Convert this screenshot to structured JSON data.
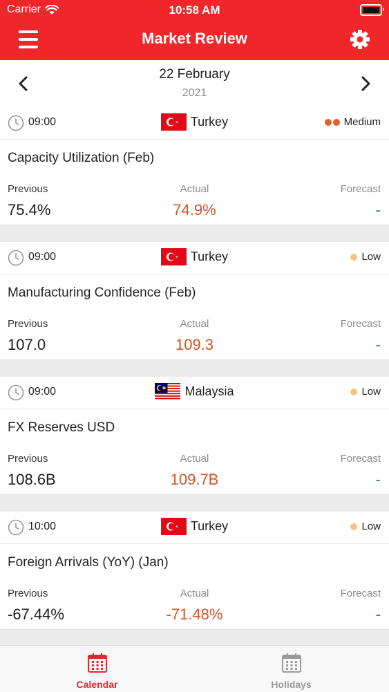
{
  "status_bar": {
    "carrier": "Carrier",
    "time": "10:58 AM"
  },
  "nav": {
    "title": "Market Review",
    "menu_icon": "hamburger-menu-icon",
    "settings_icon": "gear-icon"
  },
  "date": {
    "day": "22 February",
    "year": "2021"
  },
  "labels": {
    "previous": "Previous",
    "actual": "Actual",
    "forecast": "Forecast"
  },
  "events": [
    {
      "time": "09:00",
      "country": "Turkey",
      "impact": "Medium",
      "impact_color": "#e0622a",
      "impact_dots": 2,
      "name": "Capacity Utilization  (Feb)",
      "previous": "75.4%",
      "actual": "74.9%",
      "forecast": "-"
    },
    {
      "time": "09:00",
      "country": "Turkey",
      "impact": "Low",
      "impact_color": "#f3c57c",
      "impact_dots": 1,
      "name": "Manufacturing Confidence  (Feb)",
      "previous": "107.0",
      "actual": "109.3",
      "forecast": "-"
    },
    {
      "time": "09:00",
      "country": "Malaysia",
      "impact": "Low",
      "impact_color": "#f3c57c",
      "impact_dots": 1,
      "name": "FX Reserves USD",
      "previous": "108.6B",
      "actual": "109.7B",
      "forecast": "-"
    },
    {
      "time": "10:00",
      "country": "Turkey",
      "impact": "Low",
      "impact_color": "#f3c57c",
      "impact_dots": 1,
      "name": "Foreign Arrivals (YoY)  (Jan)",
      "previous": "-67.44%",
      "actual": "-71.48%",
      "forecast": "-"
    }
  ],
  "tabs": [
    {
      "label": "Calendar",
      "icon": "calendar-icon",
      "active": true
    },
    {
      "label": "Holidays",
      "icon": "calendar-icon",
      "active": false
    }
  ],
  "colors": {
    "brand": "#f0262b",
    "actual": "#d45326",
    "forecast": "#2a6db5",
    "active_tab": "#e0282d"
  }
}
